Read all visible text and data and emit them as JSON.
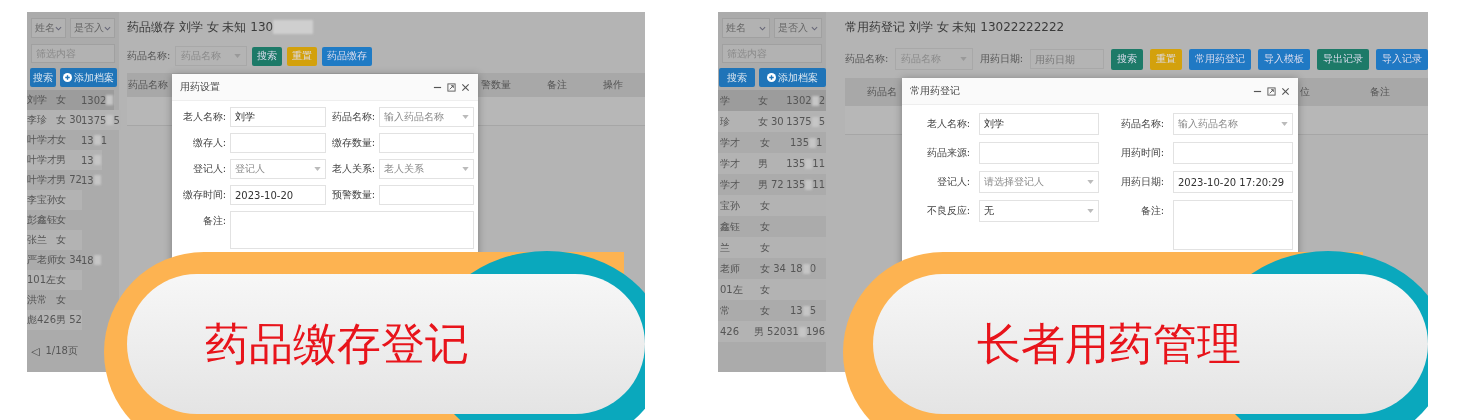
{
  "panels": [
    {
      "sidebar": {
        "filters": [
          {
            "label": "姓名"
          },
          {
            "label": "是否入"
          }
        ],
        "search": {
          "placeholder": "筛选内容"
        },
        "buttons": [
          {
            "label": "搜索",
            "kind": "search"
          },
          {
            "label": "添加档案",
            "kind": "add"
          }
        ],
        "residents": [
          {
            "name": "刘学",
            "sex_age": "女",
            "phone_start": "1302",
            "selected": true
          },
          {
            "name": "李珍",
            "sex_age": "女 30",
            "phone_start": "1375",
            "phone_end": "5",
            "selected": false
          },
          {
            "name": "叶学才",
            "sex_age": "女",
            "phone_start": "13",
            "phone_end": "1",
            "selected": false
          },
          {
            "name": "叶学才",
            "sex_age": "男",
            "phone_start": "13",
            "selected": false
          },
          {
            "name": "叶学才",
            "sex_age": "男 72",
            "phone_start": "13",
            "selected": false
          },
          {
            "name": "李宝孙",
            "sex_age": "女",
            "selected": false
          },
          {
            "name": "彭鑫钰",
            "sex_age": "女",
            "selected": false
          },
          {
            "name": "张兰",
            "sex_age": "女",
            "selected": false
          },
          {
            "name": "严老师",
            "sex_age": "女 34",
            "phone_start": "18",
            "selected": false
          },
          {
            "name": "101左",
            "sex_age": "女",
            "selected": false
          },
          {
            "name": "洪常",
            "sex_age": "女",
            "selected": false
          },
          {
            "name": "彪426",
            "sex_age": "男 52",
            "selected": false
          }
        ],
        "pager": {
          "prev": "◁",
          "page": "1/18页"
        }
      },
      "title": "药品缴存 刘学 女 未知 130",
      "title_masked": true,
      "toolbar": {
        "fields": [
          {
            "label": "药品名称:",
            "kind": "select",
            "placeholder": "药品名称"
          }
        ],
        "buttons": [
          {
            "label": "搜索",
            "color": "#1d7a68"
          },
          {
            "label": "重置",
            "color": "#d3a10c"
          },
          {
            "label": "药品缴存",
            "color": "#1f7bc5"
          }
        ]
      },
      "table": {
        "columns": [
          "药品名称",
          "警数量",
          "备注",
          "操作"
        ]
      },
      "dialog": {
        "title": "用药设置",
        "fields": [
          {
            "label": "老人名称:",
            "kind": "input",
            "value": "刘学"
          },
          {
            "label": "药品名称:",
            "kind": "select",
            "placeholder": "输入药品名称"
          },
          {
            "label": "缴存人:",
            "kind": "input"
          },
          {
            "label": "缴存数量:",
            "kind": "input"
          },
          {
            "label": "登记人:",
            "kind": "select",
            "placeholder": "登记人"
          },
          {
            "label": "老人关系:",
            "kind": "select",
            "placeholder": "老人关系"
          },
          {
            "label": "缴存时间:",
            "kind": "input",
            "value": "2023-10-20"
          },
          {
            "label": "预警数量:",
            "kind": "input"
          },
          {
            "label": "备注:",
            "kind": "textarea",
            "wide": true
          }
        ]
      },
      "caption": "药品缴存登记"
    },
    {
      "sidebar": {
        "filters": [
          {
            "label": "姓名"
          },
          {
            "label": "是否入"
          }
        ],
        "search": {
          "placeholder": "筛选内容"
        },
        "buttons": [
          {
            "label": "搜索",
            "kind": "search"
          },
          {
            "label": "添加档案",
            "kind": "add"
          }
        ],
        "residents": [
          {
            "name": "学",
            "sex_age": "女",
            "phone_start": "1302",
            "phone_end": "2",
            "selected": true
          },
          {
            "name": "珍",
            "sex_age": "女 30",
            "phone_start": "1375",
            "phone_end": "5",
            "selected": false
          },
          {
            "name": "学才",
            "sex_age": "女",
            "phone_start": "135",
            "phone_end": "1",
            "selected": false
          },
          {
            "name": "学才",
            "sex_age": "男",
            "phone_start": "135",
            "phone_end": "11",
            "selected": false
          },
          {
            "name": "学才",
            "sex_age": "男 72",
            "phone_start": "135",
            "phone_end": "11",
            "selected": false
          },
          {
            "name": "宝孙",
            "sex_age": "女",
            "selected": false
          },
          {
            "name": "鑫钰",
            "sex_age": "女",
            "selected": false
          },
          {
            "name": "兰",
            "sex_age": "女",
            "selected": false
          },
          {
            "name": "老师",
            "sex_age": "女 34",
            "phone_start": "18",
            "phone_end": "0",
            "selected": false
          },
          {
            "name": "01左",
            "sex_age": "女",
            "selected": false
          },
          {
            "name": "常",
            "sex_age": "女",
            "phone_start": "13",
            "phone_end": "5",
            "selected": false
          },
          {
            "name": "426",
            "sex_age": "男 52",
            "phone_start": "031",
            "phone_end": "196",
            "selected": false
          }
        ]
      },
      "title": "常用药登记 刘学 女 未知 13022222222",
      "toolbar": {
        "fields": [
          {
            "label": "药品名称:",
            "kind": "select",
            "placeholder": "药品名称"
          },
          {
            "label": "用药日期:",
            "kind": "input",
            "placeholder": "用药日期"
          }
        ],
        "buttons": [
          {
            "label": "搜索",
            "color": "#1d7a68"
          },
          {
            "label": "重置",
            "color": "#d3a10c"
          },
          {
            "label": "常用药登记",
            "color": "#2079c4"
          },
          {
            "label": "导入模板",
            "color": "#2079c4"
          },
          {
            "label": "导出记录",
            "color": "#1d7a68"
          },
          {
            "label": "导入记录",
            "color": "#2079c4"
          }
        ]
      },
      "table": {
        "columns": [
          "药品名",
          "位",
          "备注"
        ]
      },
      "dialog": {
        "title": "常用药登记",
        "fields": [
          {
            "label": "老人名称:",
            "kind": "input",
            "value": "刘学"
          },
          {
            "label": "药品名称:",
            "kind": "select",
            "placeholder": "输入药品名称"
          },
          {
            "label": "药品来源:",
            "kind": "input"
          },
          {
            "label": "用药时间:",
            "kind": "input"
          },
          {
            "label": "登记人:",
            "kind": "select",
            "placeholder": "请选择登记人"
          },
          {
            "label": "用药日期:",
            "kind": "input",
            "value": "2023-10-20 17:20:29"
          },
          {
            "label": "不良反应:",
            "kind": "select",
            "value": "无"
          },
          {
            "label": "备注:",
            "kind": "textarea"
          }
        ]
      },
      "caption": "长者用药管理"
    }
  ]
}
